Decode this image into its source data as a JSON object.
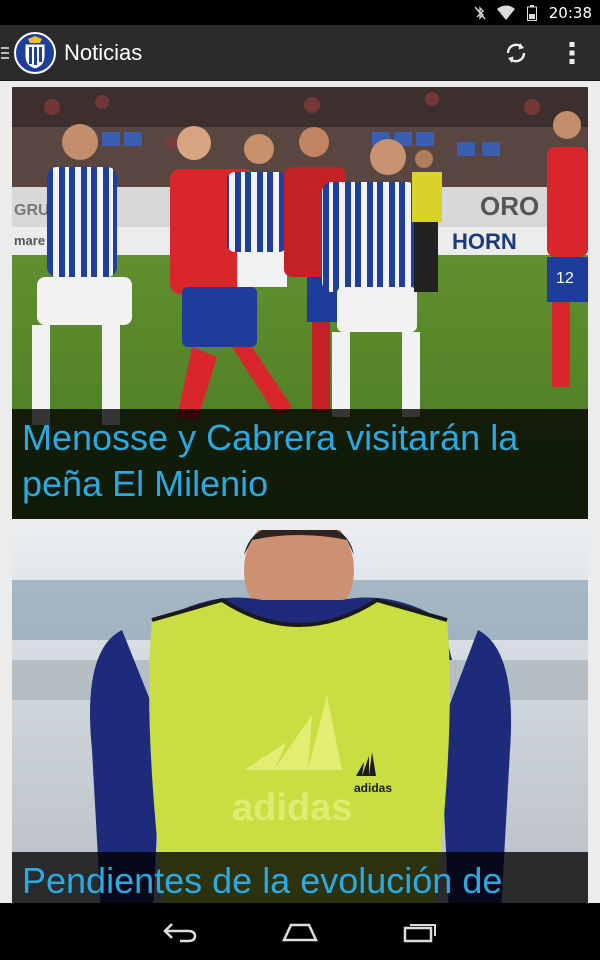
{
  "status_bar": {
    "time": "20:38",
    "icons": [
      "bluetooth-off-icon",
      "wifi-icon",
      "battery-icon"
    ]
  },
  "action_bar": {
    "title": "Noticias",
    "icons": [
      "drawer-indicator-icon",
      "club-crest-logo",
      "refresh-icon",
      "overflow-menu-icon"
    ]
  },
  "news": [
    {
      "headline": "Menosse y Cabrera visitarán la peña El Milenio",
      "image": "football-match-photo"
    },
    {
      "headline": "Pendientes de la evolución de",
      "image": "player-training-photo"
    }
  ],
  "nav_bar": {
    "icons": [
      "back-icon",
      "home-icon",
      "recents-icon"
    ]
  },
  "colors": {
    "headline": "#2ba9e1",
    "action_bar": "#2b2b2b",
    "background": "#ececec"
  }
}
